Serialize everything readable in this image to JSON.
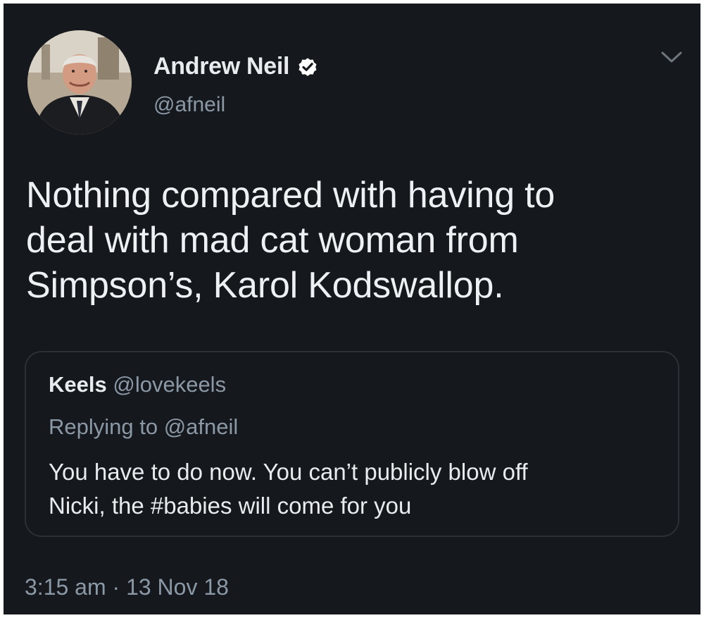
{
  "author": {
    "display_name": "Andrew Neil",
    "handle": "@afneil",
    "verified": true,
    "avatar_icon": "profile-photo"
  },
  "menu_icon": "chevron-down-icon",
  "tweet": {
    "text_lines": [
      "Nothing compared with having to",
      "deal with mad cat woman from",
      "Simpson’s, Karol Kodswallop."
    ]
  },
  "quoted_tweet": {
    "name": "Keels",
    "handle": "@lovekeels",
    "replying_to": "Replying to @afneil",
    "text_lines": [
      "You have to do now. You can’t publicly blow off",
      "Nicki, the #babies will come for you"
    ]
  },
  "timestamp": "3:15 am · 13 Nov 18",
  "colors": {
    "background": "#15181c",
    "primary_text": "#e9ecee",
    "secondary_text": "#8b98a5",
    "border": "#2b3036",
    "verified_badge": "#ffffff"
  }
}
